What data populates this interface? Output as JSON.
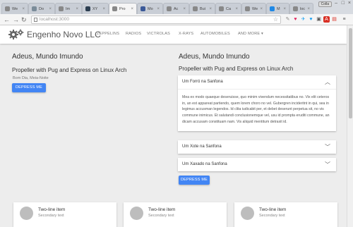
{
  "browser": {
    "tabs": [
      {
        "label": "We",
        "color": "#888888",
        "active": false
      },
      {
        "label": "Do",
        "color": "#7b8c99",
        "active": false
      },
      {
        "label": "Im",
        "color": "#888888",
        "active": false
      },
      {
        "label": "XY",
        "color": "#2c3e50",
        "active": false
      },
      {
        "label": "Pro",
        "color": "#888888",
        "active": true
      },
      {
        "label": "Mo",
        "color": "#3b5998",
        "active": false
      },
      {
        "label": "Ac",
        "color": "#888888",
        "active": false
      },
      {
        "label": "Bui",
        "color": "#888888",
        "active": false
      },
      {
        "label": "Ca",
        "color": "#888888",
        "active": false
      },
      {
        "label": "We",
        "color": "#888888",
        "active": false
      },
      {
        "label": "M",
        "color": "#1e88e5",
        "active": false
      },
      {
        "label": "loc",
        "color": "#888888",
        "active": false
      }
    ],
    "user_badge": "Colla",
    "window_controls": [
      "–",
      "□",
      "×"
    ],
    "address_scheme": "localhost:",
    "address_port": "3000",
    "extensions": [
      {
        "glyph": "✎",
        "color": "#888888"
      },
      {
        "glyph": "♥",
        "color": "#e0245e"
      },
      {
        "glyph": "✈",
        "color": "#1da1f2"
      },
      {
        "glyph": "♥",
        "color": "#1da1f2"
      },
      {
        "glyph": "▣",
        "color": "#555555"
      },
      {
        "glyph": "A",
        "color": "#ffffff",
        "bg": "#d93025"
      },
      {
        "glyph": "▤",
        "color": "#d93025"
      },
      {
        "glyph": "≡",
        "color": "#555555"
      }
    ]
  },
  "app": {
    "brand": "Engenho Novo LLC",
    "nav": [
      "ZEPPELINS",
      "RADIOS",
      "VICTROLAS",
      "X-RAYS",
      "AUTOMOBILES",
      "AND MORE"
    ],
    "nav_more_caret": "▾"
  },
  "left": {
    "title": "Adeus, Mundo Imundo",
    "subtitle": "Propeller with Pug and Express on Linux Arch",
    "small": "Bom Dia, Meia-Noite",
    "button": "DEPRESS ME"
  },
  "right": {
    "title": "Adeus, Mundo Imundo",
    "subtitle": "Propeller with Pug and Express on Linux Arch",
    "accordion": [
      {
        "title": "Um Forró na Sanfona",
        "expanded": true,
        "body": "Mea ex modo quaeque deseruisse, quo minim vivendum necessitatibus no. Vix elit ceteros in, an est appareat partiendo, quem lorem choro no vel. Gubergren incideritnt in qui, sea in legimus accusman legendos. Id clita iudicabit per, et debet deserunt perpetua sit, no vis commune inimicus. Et salutandi conclusionemque vel, usu id prompta eruditi commune, an dicam accusam constituam nam. Vis aliquid mentitum detraxit id."
      },
      {
        "title": "Um Xote na Sanfona",
        "expanded": false
      },
      {
        "title": "Um Xaxado na Sanfona",
        "expanded": false
      }
    ],
    "button": "DEPRESS ME"
  },
  "cards": [
    {
      "line1": "Two-line item",
      "line2": "Secondary text"
    },
    {
      "line1": "Two-line item",
      "line2": "Secondary text"
    },
    {
      "line1": "Two-line item",
      "line2": "Secondary text"
    }
  ]
}
